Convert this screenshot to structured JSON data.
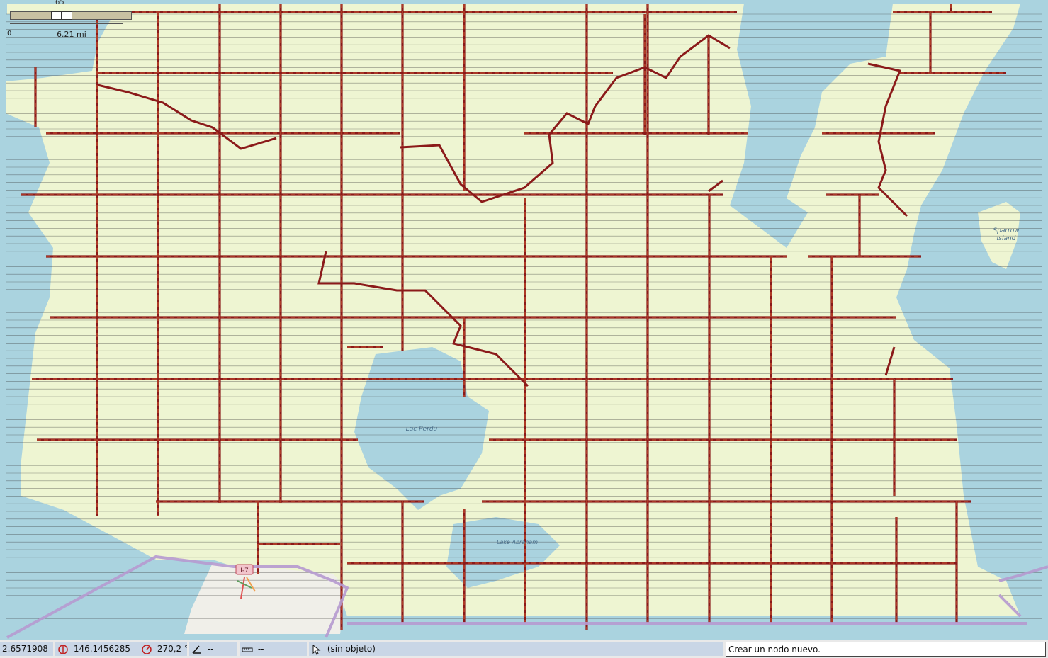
{
  "scale": {
    "zoom_label": "65",
    "zero_label": "0",
    "distance_label": "6.21 mi"
  },
  "map": {
    "labels": [
      {
        "key": "lac_perdu",
        "text": "Lac Perdu"
      },
      {
        "key": "lake_abraham",
        "text": "Lake Abraham"
      },
      {
        "key": "sparrow_island_1",
        "text": "Sparrow"
      },
      {
        "key": "sparrow_island_2",
        "text": "Island"
      }
    ],
    "road_shield": "I-7",
    "colors": {
      "water": "#aad3df",
      "land": "#eef5d2",
      "road": "#8b1a1a",
      "road_casing": "#b22222",
      "boundary": "#b69ad0",
      "urban": "#f0efe9"
    }
  },
  "status": {
    "latitude": "2.6571908",
    "longitude": "146.1456285",
    "heading": "270,2 °",
    "angle": "--",
    "distance": "--",
    "selection": "(sin objeto)",
    "message": "Crear un nodo nuevo."
  }
}
